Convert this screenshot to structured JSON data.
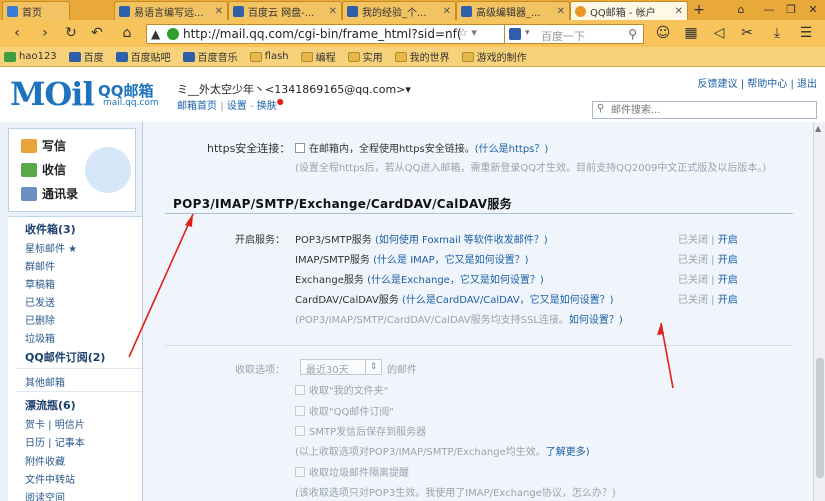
{
  "browser": {
    "tabs": [
      {
        "title": "首页",
        "active": false
      },
      {
        "title": "易语言编写远...",
        "active": false
      },
      {
        "title": "百度云 网盘-...",
        "active": false
      },
      {
        "title": "我的经验_个...",
        "active": false
      },
      {
        "title": "高级编辑器_...",
        "active": false
      },
      {
        "title": "QQ邮箱 - 帐户",
        "active": true
      }
    ],
    "url": "http://mail.qq.com/cgi-bin/frame_html?sid=nf(",
    "search_placeholder": "百度一下",
    "bookmarks": [
      "hao123",
      "百度",
      "百度贴吧",
      "百度音乐",
      "flash",
      "编程",
      "实用",
      "我的世界",
      "游戏的制作"
    ]
  },
  "mail_header": {
    "logo_text": "MOil",
    "logo_cn": "QQ邮箱",
    "logo_sub": "mail.qq.com",
    "username": "ミ__外太空少年丶<1341869165@qq.com>▾",
    "home_link": "邮箱首页",
    "settings_link": "设置",
    "skin_link": "换肤",
    "top_right_links": "反馈建议 | 帮助中心 | 退出",
    "search_placeholder": "邮件搜索..."
  },
  "sidebar": {
    "compose": "写信",
    "inbox": "收信",
    "contacts": "通讯录",
    "folders": [
      {
        "label": "收件箱(3)",
        "bold": true
      },
      {
        "label": "星标邮件 ★",
        "bold": false
      },
      {
        "label": "群邮件",
        "bold": false
      },
      {
        "label": "草稿箱",
        "bold": false
      },
      {
        "label": "已发送",
        "bold": false
      },
      {
        "label": "已删除",
        "bold": false
      },
      {
        "label": "垃圾箱",
        "bold": false
      },
      {
        "label": "QQ邮件订阅(2)",
        "bold": true
      }
    ],
    "other_mailbox": "其他邮箱",
    "extras": [
      {
        "label": "漂流瓶(6)",
        "bold": true
      },
      {
        "label": "贺卡 | 明信片",
        "bold": false
      },
      {
        "label": "日历 | 记事本",
        "bold": false
      },
      {
        "label": "附件收藏",
        "bold": false
      },
      {
        "label": "文件中转站",
        "bold": false
      },
      {
        "label": "阅读空间",
        "bold": false
      }
    ]
  },
  "main": {
    "https": {
      "label": "https安全连接：",
      "checkbox_text": "在邮箱内，全程使用https安全链接。",
      "link": "(什么是https？)",
      "note": "(设置全程https后，若从QQ进入邮箱，需重新登录QQ才生效。目前支持QQ2009中文正式版及以后版本。)"
    },
    "section_title": "POP3/IMAP/SMTP/Exchange/CardDAV/CalDAV服务",
    "services_label": "开启服务：",
    "services": [
      {
        "name": "POP3/SMTP服务",
        "help": "(如何使用 Foxmail 等软件收发邮件？)",
        "status": "已关闭",
        "action": "开启"
      },
      {
        "name": "IMAP/SMTP服务",
        "help": "(什么是 IMAP，它又是如何设置？)",
        "status": "已关闭",
        "action": "开启"
      },
      {
        "name": "Exchange服务",
        "help": "(什么是Exchange，它又是如何设置？)",
        "status": "已关闭",
        "action": "开启"
      },
      {
        "name": "CardDAV/CalDAV服务",
        "help": "(什么是CardDAV/CalDAV，它又是如何设置？)",
        "status": "已关闭",
        "action": "开启"
      }
    ],
    "ssl_note": "(POP3/IMAP/SMTP/CardDAV/CalDAV服务均支持SSL连接。",
    "ssl_link": "如何设置？)",
    "receive_label": "收取选项：",
    "range_value": "最近30天",
    "range_suffix": "的邮件",
    "opt_my_folders": "收取\"我的文件夹\"",
    "opt_subscriptions": "收取\"QQ邮件订阅\"",
    "opt_smtp_save": "SMTP发信后保存到服务器",
    "receive_note": "(以上收取选项对POP3/IMAP/SMTP/Exchange均生效。",
    "receive_note_link": "了解更多)",
    "opt_spam_notice": "收取垃圾邮件隔离提醒",
    "last_note": "(该收取选项只对POP3生效。我使用了IMAP/Exchange协议，怎么办？)"
  },
  "colors": {
    "brand_blue": "#1e73be",
    "annotation_red": "#e0201a",
    "browser_chrome": "#f6c45a"
  }
}
